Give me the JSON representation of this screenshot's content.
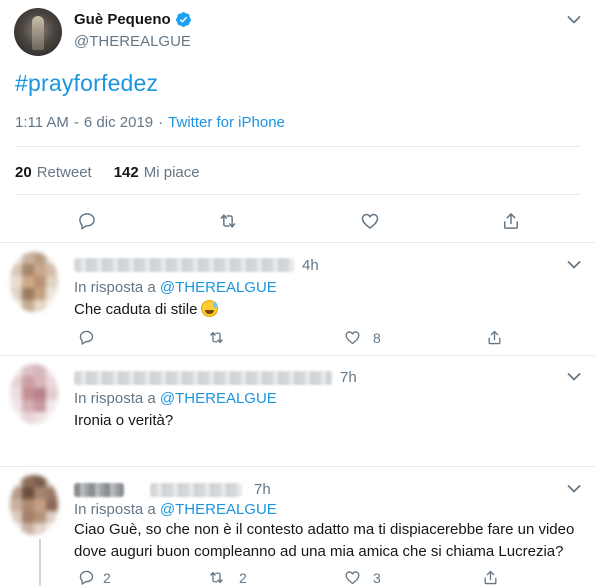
{
  "main_tweet": {
    "author_name": "Guè Pequeno",
    "author_handle": "@THEREALGUE",
    "text": "#prayforfedez",
    "time": "1:11 AM",
    "date": "6 dic 2019",
    "source": "Twitter for iPhone",
    "retweets_count": "20",
    "retweets_label": "Retweet",
    "likes_count": "142",
    "likes_label": "Mi piace"
  },
  "replies": [
    {
      "time": "4h",
      "in_reply_prefix": "In risposta a",
      "in_reply_handle": "@THEREALGUE",
      "text": "Che caduta di stile",
      "emoji": "sweat-smile-emoji",
      "reply_count": "",
      "retweet_count": "",
      "like_count": "8"
    },
    {
      "time": "7h",
      "in_reply_prefix": "In risposta a",
      "in_reply_handle": "@THEREALGUE",
      "text": "Ironia o verità?",
      "reply_count": "",
      "retweet_count": "",
      "like_count": ""
    },
    {
      "time": "7h",
      "in_reply_prefix": "In risposta a",
      "in_reply_handle": "@THEREALGUE",
      "text_line1": "Ciao Guè, so che non è il contesto adatto ma ti dispiacerebbe fare un video",
      "text_line2": "dove auguri buon compleanno ad una mia amica che si chiama Lucrezia?",
      "reply_count": "2",
      "retweet_count": "2",
      "like_count": "3"
    }
  ],
  "colors": {
    "link": "#1b95e0",
    "muted": "#657786",
    "text": "#14171a",
    "divider": "#e6ecf0",
    "verified": "#1da1f2"
  }
}
